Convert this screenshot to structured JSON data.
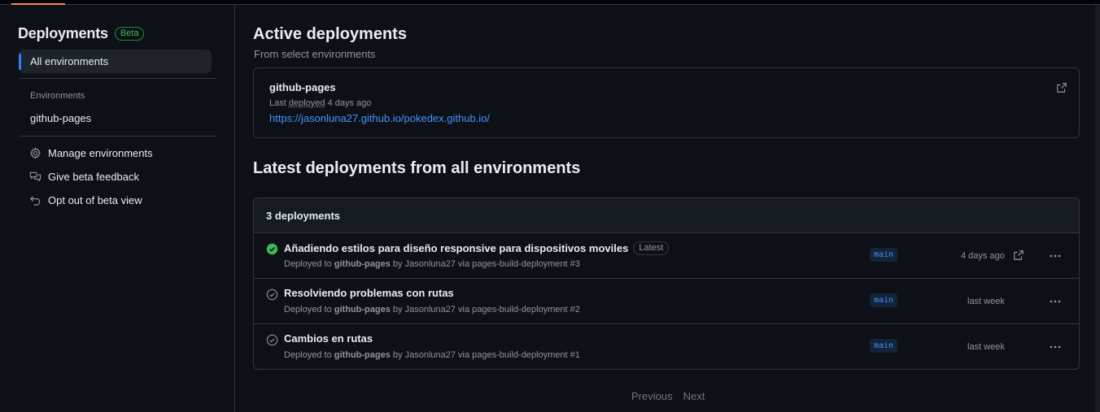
{
  "sidebar": {
    "title": "Deployments",
    "badge": "Beta",
    "selected_item": "All environments",
    "group_label": "Environments",
    "environments": [
      "github-pages"
    ],
    "actions": [
      {
        "label": "Manage environments",
        "icon": "gear-icon"
      },
      {
        "label": "Give beta feedback",
        "icon": "comment-discussion-icon"
      },
      {
        "label": "Opt out of beta view",
        "icon": "undo-icon"
      }
    ]
  },
  "active": {
    "heading": "Active deployments",
    "subheading": "From select environments",
    "card": {
      "name": "github-pages",
      "last_prefix": "Last",
      "last_link": "deployed",
      "last_suffix": "4 days ago",
      "url": "https://jasonluna27.github.io/pokedex.github.io/"
    }
  },
  "latest": {
    "heading": "Latest deployments from all environments",
    "count_label": "3 deployments",
    "rows": [
      {
        "title": "Añadiendo estilos para diseño responsive para dispositivos moviles",
        "badge": "Latest",
        "status": "success",
        "env": "github-pages",
        "user": "Jasonluna27",
        "workflow": "pages-build-deployment #3",
        "branch": "main",
        "time": "4 days ago"
      },
      {
        "title": "Resolviendo problemas con rutas",
        "status": "inactive",
        "env": "github-pages",
        "user": "Jasonluna27",
        "workflow": "pages-build-deployment #2",
        "branch": "main",
        "time": "last week"
      },
      {
        "title": "Cambios en rutas",
        "status": "inactive",
        "env": "github-pages",
        "user": "Jasonluna27",
        "workflow": "pages-build-deployment #1",
        "branch": "main",
        "time": "last week"
      }
    ],
    "meta_deployed_to": "Deployed to",
    "meta_by": "by",
    "meta_via": "via"
  },
  "pagination": {
    "previous": "Previous",
    "next": "Next"
  },
  "colors": {
    "accent": "#2f81f7",
    "success": "#3fb950",
    "link": "#4493f8"
  }
}
